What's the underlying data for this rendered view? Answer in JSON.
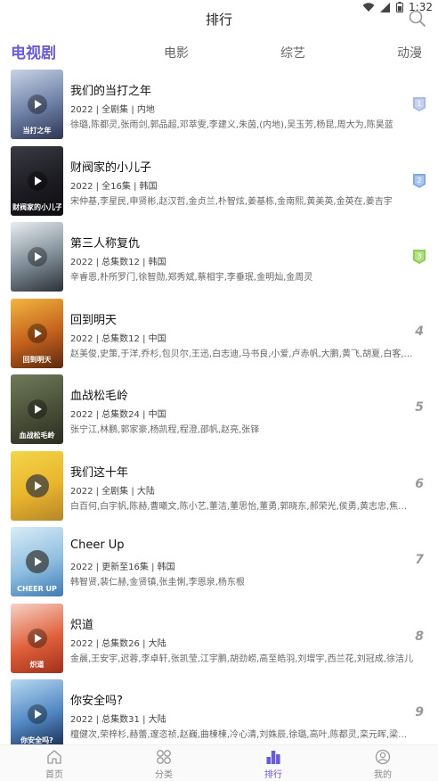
{
  "status_bar": {
    "time": "1:32"
  },
  "header": {
    "title": "排行"
  },
  "tabs": [
    {
      "label": "电视剧",
      "active": true
    },
    {
      "label": "电影",
      "active": false
    },
    {
      "label": "综艺",
      "active": false
    },
    {
      "label": "动漫",
      "active": false
    }
  ],
  "list": [
    {
      "title": "我们的当打之年",
      "meta": "2022 | 全剧集 | 内地",
      "cast": "徐璐,陈都灵,张雨剑,郭品超,邓萃雯,李建义,朱茵,(内地),吴玉芳,杨昆,周大为,陈昊蓝",
      "rank": "1",
      "medal": true,
      "medal_color": "#a9b8e8",
      "poster_colors": [
        "#c9d3e6",
        "#6c7fa6",
        "#2e3550"
      ],
      "poster_text": "当打之年"
    },
    {
      "title": "财阀家的小儿子",
      "meta": "2022 | 全16集 | 韩国",
      "cast": "宋仲基,李星民,申贤彬,赵汉哲,金贞兰,朴智炫,姜基栋,金南熙,黄美英,金英在,姜吉宇",
      "rank": "2",
      "medal": true,
      "medal_color": "#7fa9e8",
      "poster_colors": [
        "#3a3a44",
        "#1c1c22",
        "#0c0c10"
      ],
      "poster_text": "财阀家的小儿子"
    },
    {
      "title": "第三人称复仇",
      "meta": "2022 | 总集数12 | 韩国",
      "cast": "辛睿恩,朴所罗门,徐智勋,郑秀斌,蔡相宇,李垂珉,金明灿,金周灵",
      "rank": "3",
      "medal": true,
      "medal_color": "#8ccf4a",
      "poster_colors": [
        "#e8eef2",
        "#7d8b95",
        "#2b3036"
      ],
      "poster_text": ""
    },
    {
      "title": "回到明天",
      "meta": "2022 | 总集数12 | 中国",
      "cast": "赵美俊,史策,于洋,乔杉,包贝尔,王迅,白志迪,马书良,小爱,卢赤帆,大鹏,黄飞,胡夏,白客,崔志佳",
      "rank": "4",
      "medal": false,
      "poster_colors": [
        "#f2b640",
        "#c4601c",
        "#5a2a10"
      ],
      "poster_text": "回到明天"
    },
    {
      "title": "血战松毛岭",
      "meta": "2022 | 总集数24 | 中国",
      "cast": "张宁江,林鹏,郭家豪,杨凯程,程澄,邵帆,赵亮,张铎",
      "rank": "5",
      "medal": false,
      "poster_colors": [
        "#6f7a5a",
        "#4a5038",
        "#2a2c20"
      ],
      "poster_text": "血战松毛岭"
    },
    {
      "title": "我们这十年",
      "meta": "2022 | 全剧集 | 大陆",
      "cast": "白百何,白宇帆,陈赫,曹曦文,陈小艺,董洁,董思怡,董勇,郭晓东,郝荣光,侯勇,黄志忠,焦俊艳,金士杰",
      "rank": "6",
      "medal": false,
      "poster_colors": [
        "#f4d54a",
        "#e9b52c",
        "#b5862a"
      ],
      "poster_text": ""
    },
    {
      "title": "Cheer Up",
      "meta": "2022 | 更新至16集 | 韩国",
      "cast": "韩智贤,裴仁赫,金贤镇,张圭悧,李恩泉,杨东根",
      "rank": "7",
      "medal": false,
      "poster_colors": [
        "#d9ecf7",
        "#8fbfe0",
        "#3f7ab3"
      ],
      "poster_text": "CHEER UP"
    },
    {
      "title": "炽道",
      "meta": "2022 | 总集数26 | 大陆",
      "cast": "金晨,王安宇,迟蓉,李卓轩,张凯莹,江宇鹏,胡劲崂,高至皓羽,刘增宇,西兰花,刘冠成,徐洁儿",
      "rank": "8",
      "medal": false,
      "poster_colors": [
        "#f6d2c8",
        "#e0603a",
        "#a0301c"
      ],
      "poster_text": "炽道"
    },
    {
      "title": "你安全吗?",
      "meta": "2022 | 总集数31 | 大陆",
      "cast": "檀健次,荣梓杉,赫蕾,邃恣祯,赵巍,曲楝楝,冷心清,刘姝辰,徐璐,高叶,陈都灵,栾元晖,梁大维,张宇",
      "rank": "9",
      "medal": false,
      "poster_colors": [
        "#b7d9f2",
        "#4f86c2",
        "#1a2a4a"
      ],
      "poster_text": "你安全吗?"
    }
  ],
  "bottom_nav": [
    {
      "label": "首页",
      "icon": "home-icon",
      "active": false
    },
    {
      "label": "分类",
      "icon": "grid-icon",
      "active": false
    },
    {
      "label": "排行",
      "icon": "ranking-icon",
      "active": true
    },
    {
      "label": "我的",
      "icon": "profile-icon",
      "active": false
    }
  ],
  "colors": {
    "accent": "#6a5bd6",
    "rank_text": "#999999"
  }
}
